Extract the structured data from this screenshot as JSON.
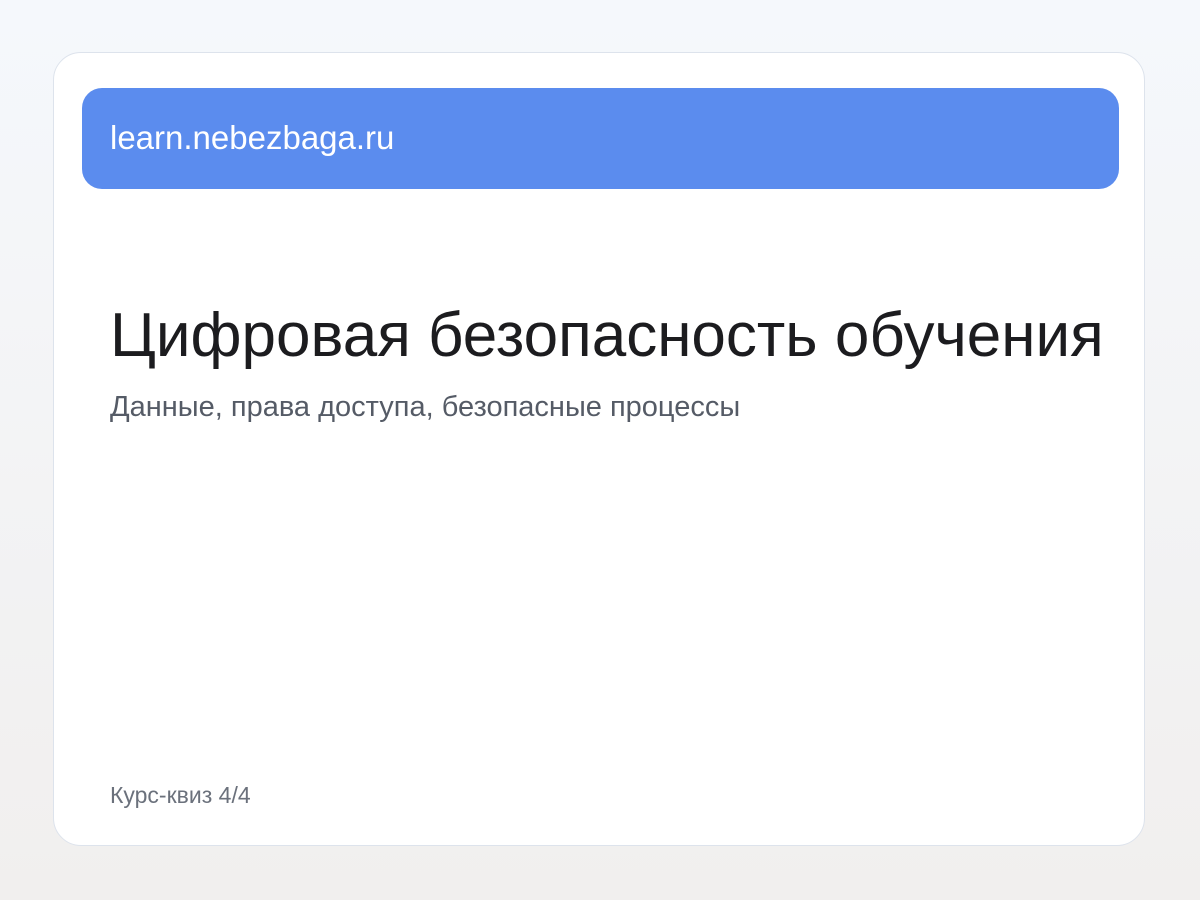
{
  "address_bar": {
    "url": "learn.nebezbaga.ru"
  },
  "slide": {
    "title": "Цифровая безопасность обучения",
    "subtitle": "Данные, права доступа, безопасные процессы",
    "progress_label": "Курс-квиз 4/4"
  },
  "colors": {
    "accent": "#5b8cee",
    "card_background": "#ffffff",
    "title_text": "#1c1c1f",
    "subtitle_text": "#555b66"
  }
}
